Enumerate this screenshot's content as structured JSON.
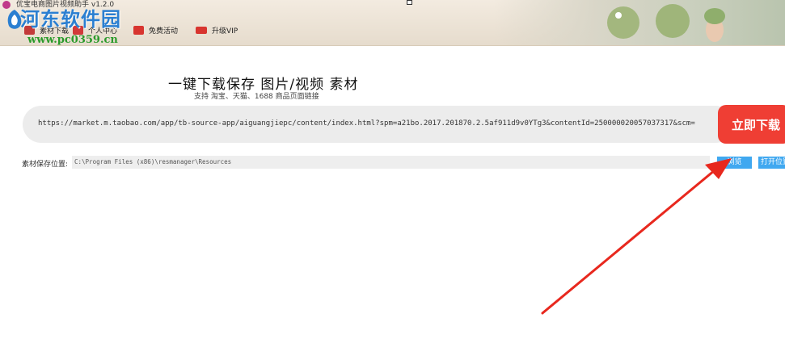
{
  "window": {
    "title": "优宝电商图片视频助手 v1.2.0"
  },
  "nav": [
    {
      "label": "素材下载",
      "icon": "download-icon"
    },
    {
      "label": "个人中心",
      "icon": "user-icon"
    },
    {
      "label": "免费活动",
      "icon": "gift-icon"
    },
    {
      "label": "升级VIP",
      "icon": "vip-icon"
    }
  ],
  "watermark": {
    "text": "河东软件园",
    "url": "www.pc0359.cn"
  },
  "main": {
    "headline": "一键下载保存 图片/视频 素材",
    "subline": "支持 淘宝、天猫、1688 商品页面链接",
    "url_value": "https://market.m.taobao.com/app/tb-source-app/aiguangjiepc/content/index.html?spm=a21bo.2017.201870.2.5af911d9v0YTg3&contentId=250000020057037317&scm=",
    "download_label": "立即下载",
    "path_label": "素材保存位置:",
    "path_value": "C:\\Program Files (x86)\\resmanager\\Resources",
    "browse_label": "浏览",
    "open_label": "打开位置"
  },
  "colors": {
    "accent_red": "#ef3e34",
    "button_blue": "#40a8f0",
    "annotation_arrow": "#e8281e"
  }
}
